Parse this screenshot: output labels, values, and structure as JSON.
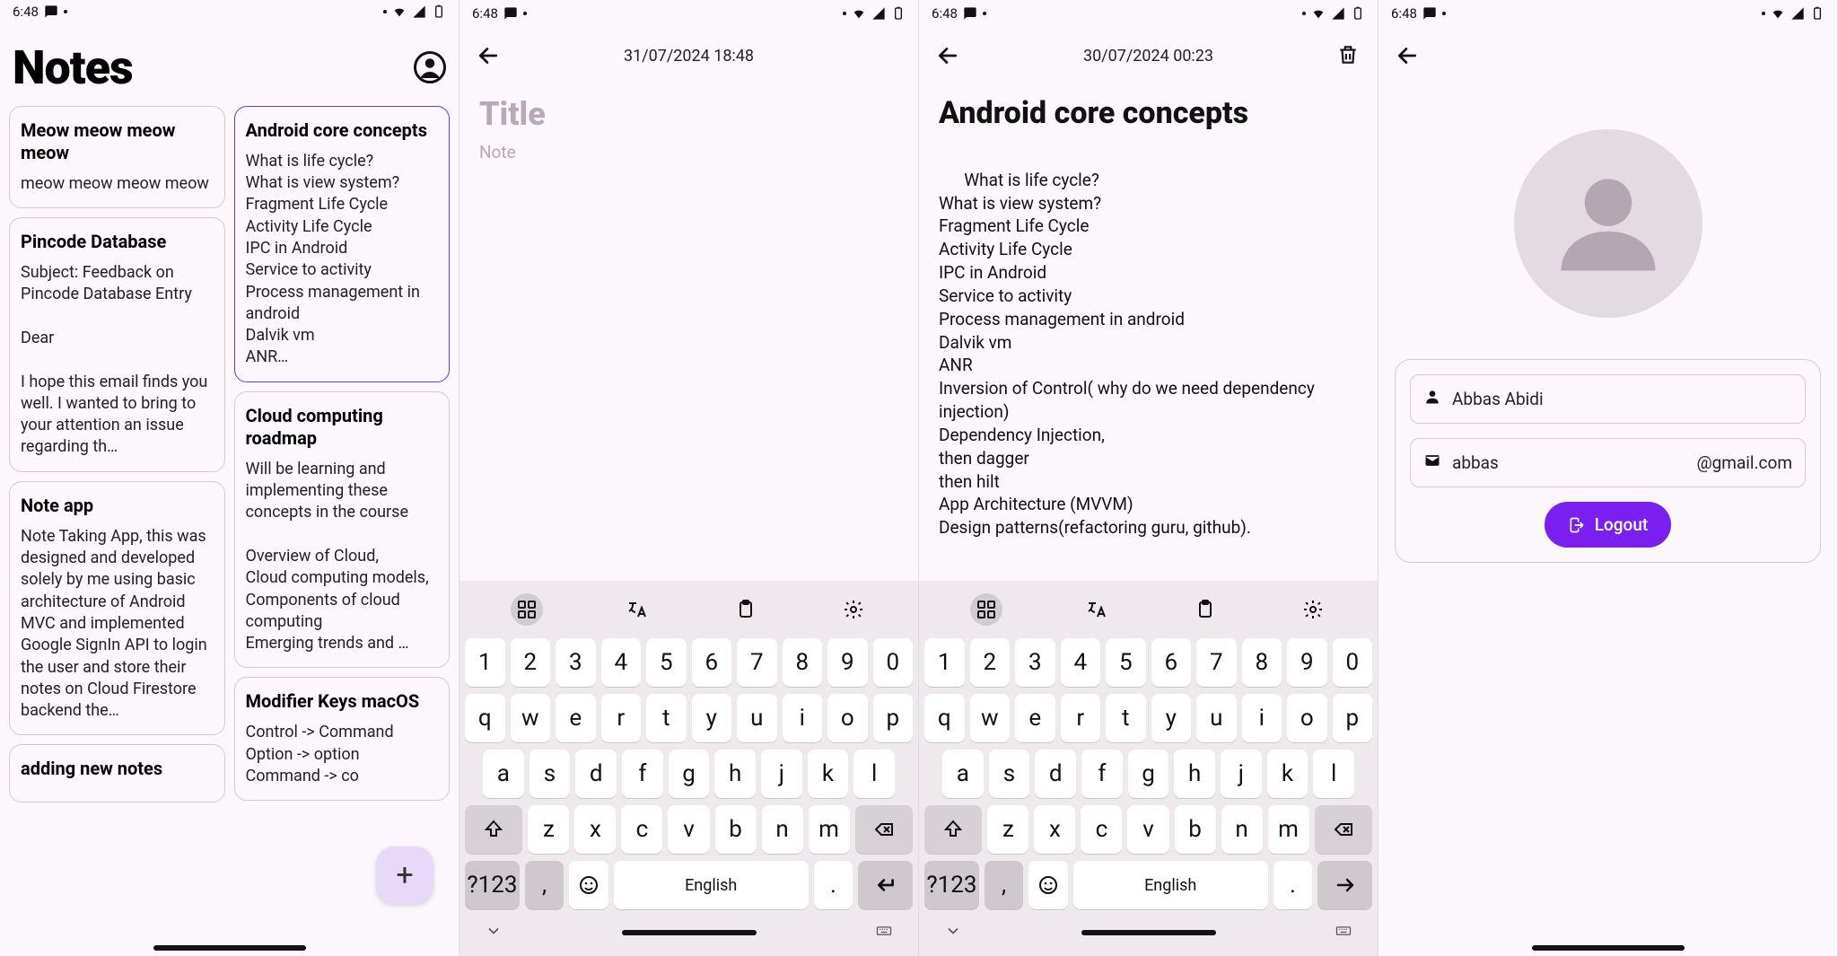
{
  "status": {
    "time": "6:48"
  },
  "screen1": {
    "title": "Notes",
    "fab": "+",
    "left_col": [
      {
        "title": "Meow meow meow meow",
        "body": "meow meow meow meow"
      },
      {
        "title": "Pincode Database",
        "body": "Subject: Feedback on Pincode Database Entry\n\nDear\n\nI hope this email finds you well. I wanted to bring to your attention an issue regarding th…"
      },
      {
        "title": "Note app",
        "body": "Note Taking App, this was designed and developed solely by me using basic architecture of Android MVC and implemented Google SignIn API to login the user and store their notes on Cloud Firestore backend the…"
      },
      {
        "title": "adding new notes",
        "body": ""
      }
    ],
    "right_col": [
      {
        "title": "Android core concepts",
        "body": "What is life cycle?\nWhat is view system?\nFragment Life Cycle\nActivity Life Cycle\nIPC in Android\nService to activity\nProcess management in android\nDalvik vm\nANR…",
        "selected": true
      },
      {
        "title": "Cloud computing roadmap",
        "body": "Will be learning and implementing these concepts in the course\n\nOverview of Cloud,\nCloud computing models,\nComponents of cloud computing\nEmerging trends and …"
      },
      {
        "title": "Modifier Keys macOS",
        "body": "Control -> Command\nOption -> option\nCommand -> co"
      }
    ]
  },
  "screen2": {
    "datestamp": "31/07/2024 18:48",
    "title_placeholder": "Title",
    "note_placeholder": "Note"
  },
  "screen3": {
    "datestamp": "30/07/2024 00:23",
    "title": "Android core concepts",
    "body": "What is life cycle?\nWhat is view system?\nFragment Life Cycle\nActivity Life Cycle\nIPC in Android\nService to activity\nProcess management in android\nDalvik vm\nANR\nInversion of Control( why do we need dependency injection)\nDependency Injection,\nthen dagger\nthen hilt\nApp Architecture (MVVM)\nDesign patterns(refactoring guru, github)."
  },
  "screen4": {
    "name": "Abbas Abidi",
    "email_left": "abbas",
    "email_right": "@gmail.com",
    "logout": "Logout"
  },
  "keyboard": {
    "row1": [
      "1",
      "2",
      "3",
      "4",
      "5",
      "6",
      "7",
      "8",
      "9",
      "0"
    ],
    "row2": [
      "q",
      "w",
      "e",
      "r",
      "t",
      "y",
      "u",
      "i",
      "o",
      "p"
    ],
    "row3": [
      "a",
      "s",
      "d",
      "f",
      "g",
      "h",
      "j",
      "k",
      "l"
    ],
    "row4": [
      "z",
      "x",
      "c",
      "v",
      "b",
      "n",
      "m"
    ],
    "sym": "?123",
    "comma": ",",
    "period": ".",
    "space": "English"
  }
}
